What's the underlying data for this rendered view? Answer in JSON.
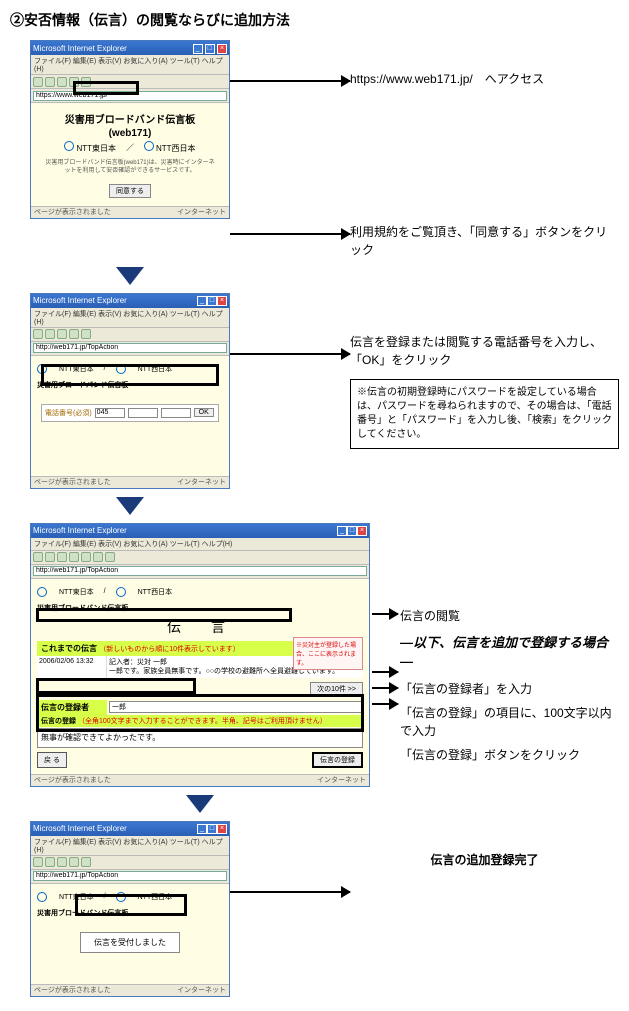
{
  "heading": "②安否情報（伝言）の閲覧ならびに追加方法",
  "browser": {
    "title": "Microsoft Internet Explorer",
    "menu": "ファイル(F)  編集(E)  表示(V)  お気に入り(A)  ツール(T)  ヘルプ(H)",
    "addr1": "https://www.web171.jp/",
    "addr2": "http://web171.jp/TopAction",
    "status_done": "ページが表示されました",
    "status_net": "インターネット"
  },
  "step1": {
    "siteTitle": "災害用ブロードバンド伝言板",
    "siteSub": "(web171)",
    "nttEast": "NTT東日本",
    "nttWest": "NTT西日本",
    "desc": "災害用ブロードバンド伝言板(web171)は、災害時にインターネットを利用して安否確認ができるサービスです。",
    "agree": "同意する",
    "annot": "https://www.web171.jp/　へアクセス"
  },
  "step2": {
    "annot": "利用規約をご覧頂き、「同意する」ボタンをクリック"
  },
  "step3": {
    "label": "電話番号(必須)",
    "v1": "045",
    "v2": "",
    "v3": "",
    "ok": "OK",
    "annot": "伝言を登録または閲覧する電話番号を入力し、「OK」をクリック",
    "note": "※伝言の初期登録時にパスワードを設定している場合は、パスワードを尋ねられますので、その場合は、「電話番号」と「パスワード」を入力し後、「検索」をクリックしてください。"
  },
  "step4": {
    "headerSmall": "災害用ブロードバンド伝言板",
    "bigTitle": "伝　言",
    "band1a": "これまでの伝言",
    "band1b": "（新しいものから順に10件表示しています）",
    "ts": "2006/02/06 13:32",
    "msgAuthor": "記入者：災対 一郎",
    "msgBody": "一郎です。家族全員無事です。○○の学校の避難所へ全員避難しています。",
    "redNote": "※災対主が登録した場合、ここに表示されます。",
    "nextBtn": "次の10件 >>",
    "regLabel": "伝言の登録者",
    "regVal": "一郎",
    "regNote1": "伝言の登録",
    "regNote2": "（全角100文字まで入力することができます。半角、記号はご利用頂けません）",
    "textarea": "無事が確認できてよかったです。",
    "back": "戻 る",
    "submit": "伝言の登録",
    "annot_view": "伝言の閲覧",
    "annot_sub": "―以下、伝言を追加で登録する場合―",
    "annot_reg1": "「伝言の登録者」を入力",
    "annot_reg2": "「伝言の登録」の項目に、100文字以内で入力",
    "annot_reg3": "「伝言の登録」ボタンをクリック"
  },
  "step5": {
    "accepted": "伝言を受付しました",
    "annot": "伝言の追加登録完了"
  }
}
